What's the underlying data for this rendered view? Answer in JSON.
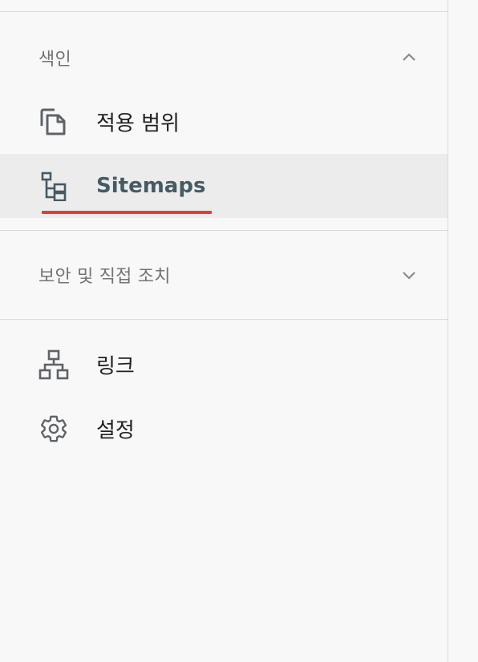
{
  "index_section": {
    "title": "색인",
    "expanded": true,
    "items": [
      {
        "label": "적용 범위",
        "icon": "coverage-pages-icon",
        "active": false
      },
      {
        "label": "Sitemaps",
        "icon": "sitemap-tree-icon",
        "active": true
      }
    ]
  },
  "security_section": {
    "title": "보안 및 직접 조치",
    "expanded": false
  },
  "bottom_items": [
    {
      "label": "링크",
      "icon": "links-network-icon"
    },
    {
      "label": "설정",
      "icon": "gear-icon"
    }
  ],
  "colors": {
    "active_underline": "#e53e30",
    "active_label": "#455a64",
    "active_background": "#ececec",
    "section_title": "#737373"
  }
}
